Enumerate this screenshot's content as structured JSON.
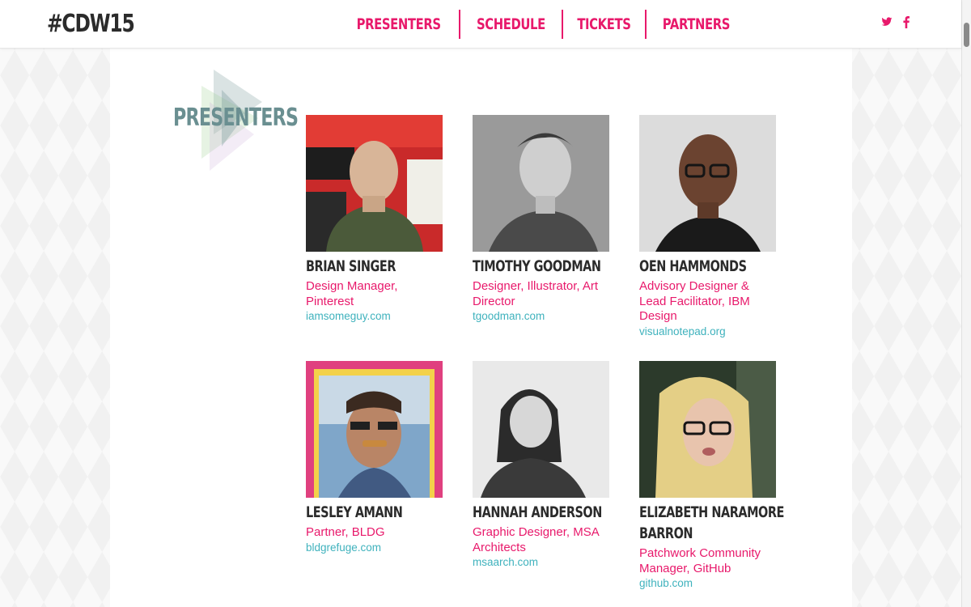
{
  "header": {
    "logo": "#CDW15",
    "nav": [
      "PRESENTERS",
      "SCHEDULE",
      "TICKETS",
      "PARTNERS"
    ],
    "social": [
      "twitter-icon",
      "facebook-icon"
    ]
  },
  "section": {
    "title": "PRESENTERS"
  },
  "presenters": [
    {
      "name": "BRIAN SINGER",
      "role": "Design Manager, Pinterest",
      "link": "iamsomeguy.com"
    },
    {
      "name": "TIMOTHY GOODMAN",
      "role": "Designer, Illustrator, Art Director",
      "link": "tgoodman.com"
    },
    {
      "name": "OEN HAMMONDS",
      "role": "Advisory Designer & Lead Facilitator, IBM Design",
      "link": "visualnotepad.org"
    },
    {
      "name": "LESLEY AMANN",
      "role": "Partner, BLDG",
      "link": "bldgrefuge.com"
    },
    {
      "name": "HANNAH ANDERSON",
      "role": "Graphic Designer, MSA Architects",
      "link": "msaarch.com"
    },
    {
      "name": "ELIZABETH NARAMORE BARRON",
      "role": "Patchwork Community Manager, GitHub",
      "link": "github.com"
    }
  ],
  "colors": {
    "accent": "#e8196b",
    "title": "#6a8f91",
    "link": "#3fb2bd",
    "text": "#2b2b2b"
  }
}
